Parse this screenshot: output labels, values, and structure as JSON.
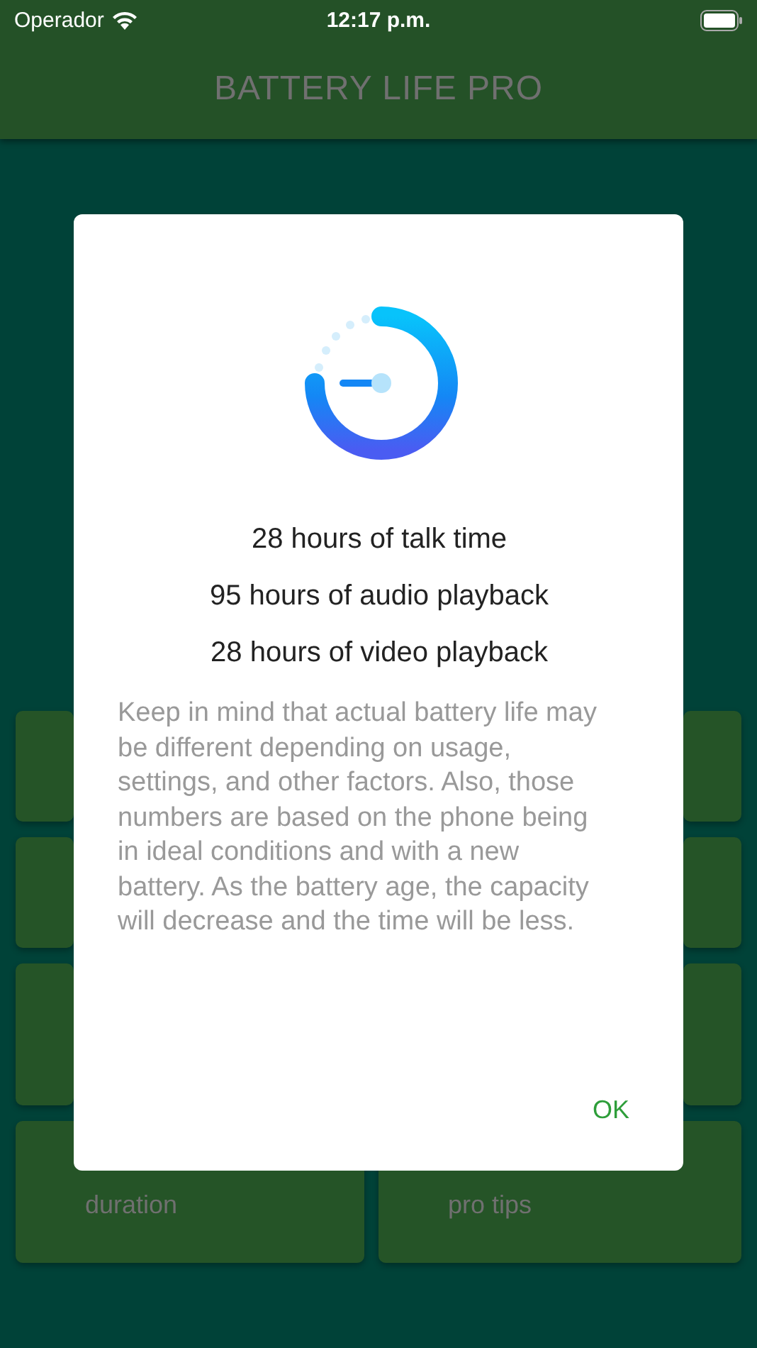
{
  "status_bar": {
    "carrier": "Operador",
    "time": "12:17 p.m."
  },
  "header": {
    "title": "BATTERY LIFE PRO"
  },
  "tiles": [
    {
      "kind": "blank"
    },
    {
      "kind": "blank"
    },
    {
      "kind": "blank"
    },
    {
      "kind": "blank"
    },
    {
      "kind": "blank"
    },
    {
      "kind": "blank"
    },
    {
      "kind": "labeled",
      "label": "duration"
    },
    {
      "kind": "labeled",
      "label": "pro tips"
    }
  ],
  "dialog": {
    "lines": [
      "28 hours of talk time",
      "95 hours of audio playback",
      "28 hours of video playback"
    ],
    "note": "Keep in mind that actual battery life may be different depending on usage, settings, and other factors. Also, those numbers are based on the phone being in ideal conditions and with a new battery. As the battery age, the capacity will decrease and the time will be less.",
    "button": "OK"
  }
}
